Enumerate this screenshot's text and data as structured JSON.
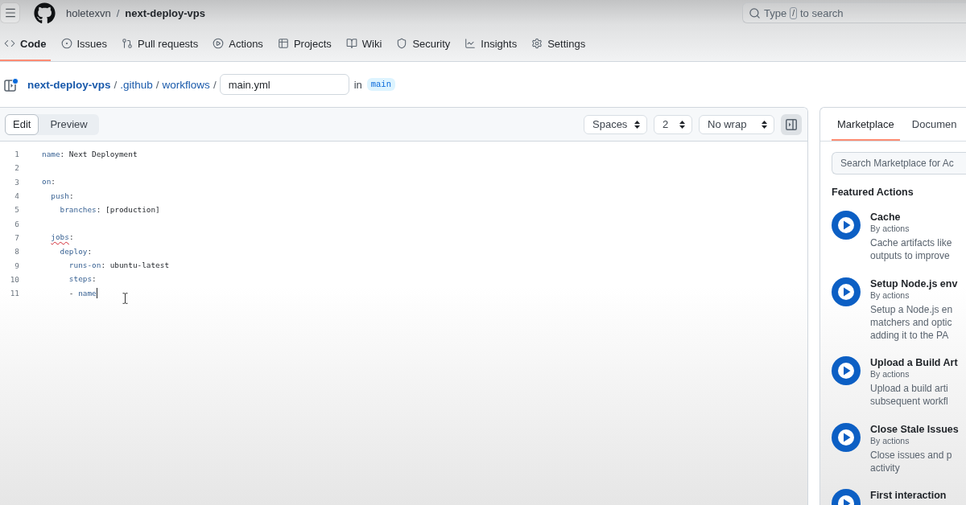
{
  "header": {
    "owner": "holetexvn",
    "separator": "/",
    "repo": "next-deploy-vps",
    "search": {
      "text_before_key": "Type",
      "shortcut_key": "/",
      "text_after_key": "to search"
    }
  },
  "nav_tabs": [
    {
      "label": "Code",
      "selected": true
    },
    {
      "label": "Issues",
      "selected": false
    },
    {
      "label": "Pull requests",
      "selected": false
    },
    {
      "label": "Actions",
      "selected": false
    },
    {
      "label": "Projects",
      "selected": false
    },
    {
      "label": "Wiki",
      "selected": false
    },
    {
      "label": "Security",
      "selected": false
    },
    {
      "label": "Insights",
      "selected": false
    },
    {
      "label": "Settings",
      "selected": false
    }
  ],
  "breadcrumb": {
    "crumbs": [
      {
        "kind": "repo",
        "text": "next-deploy-vps"
      },
      {
        "kind": "separator",
        "text": "/"
      },
      {
        "kind": "folder",
        "text": ".github"
      },
      {
        "kind": "separator",
        "text": "/"
      },
      {
        "kind": "folder",
        "text": "workflows"
      },
      {
        "kind": "separator",
        "text": "/"
      }
    ],
    "filename": {
      "value": "main.yml"
    },
    "branch_prefix": "in",
    "branch": "main"
  },
  "editor": {
    "tabs": [
      {
        "label": "Edit",
        "selected": true
      },
      {
        "label": "Preview",
        "selected": false
      }
    ],
    "selects": [
      {
        "value": "Spaces"
      },
      {
        "value": "2"
      },
      {
        "value": "No wrap"
      }
    ],
    "lines": [
      {
        "number": "1",
        "tokens": [
          {
            "kind": "key",
            "text": "name"
          },
          {
            "kind": "plain",
            "text": ": Next Deployment"
          }
        ],
        "squiggle": false,
        "caret": false
      },
      {
        "number": "2"
      },
      {
        "number": "3",
        "tokens": [
          {
            "kind": "key",
            "text": "on"
          },
          {
            "kind": "plain",
            "text": ":"
          }
        ],
        "squiggle": false,
        "caret": false
      },
      {
        "number": "4",
        "tokens": [
          {
            "kind": "key",
            "text": "  push"
          },
          {
            "kind": "plain",
            "text": ":"
          }
        ],
        "squiggle": false,
        "caret": false
      },
      {
        "number": "5",
        "tokens": [
          {
            "kind": "key",
            "text": "    branches"
          },
          {
            "kind": "plain",
            "text": ": [production]"
          }
        ],
        "squiggle": false,
        "caret": false
      },
      {
        "number": "6"
      },
      {
        "number": "7",
        "tokens": [
          {
            "kind": "key",
            "text": "  jobs"
          },
          {
            "kind": "plain",
            "text": ":"
          }
        ],
        "squiggle": true,
        "caret": false
      },
      {
        "number": "8",
        "tokens": [
          {
            "kind": "key",
            "text": "    deploy"
          },
          {
            "kind": "plain",
            "text": ":"
          }
        ],
        "squiggle": false,
        "caret": false
      },
      {
        "number": "9",
        "tokens": [
          {
            "kind": "key",
            "text": "      runs-on"
          },
          {
            "kind": "plain",
            "text": ": ubuntu-latest"
          }
        ],
        "squiggle": false,
        "caret": false
      },
      {
        "number": "10",
        "tokens": [
          {
            "kind": "key",
            "text": "      steps"
          },
          {
            "kind": "plain",
            "text": ":"
          }
        ],
        "squiggle": false,
        "caret": false
      },
      {
        "number": "11",
        "tokens": [
          {
            "kind": "plain",
            "text": "      - "
          },
          {
            "kind": "key",
            "text": "name"
          }
        ],
        "squiggle": false,
        "caret": true
      }
    ]
  },
  "sidebar": {
    "tabs": [
      {
        "label": "Marketplace",
        "selected": true
      },
      {
        "label": "Documen",
        "selected": false
      }
    ],
    "search": {
      "placeholder": "Search Marketplace for Ac"
    },
    "heading": "Featured Actions",
    "actions": [
      {
        "title": "Cache",
        "author": "By actions",
        "description_lines": [
          "Cache artifacts like",
          "outputs to improve"
        ]
      },
      {
        "title": "Setup Node.js env",
        "author": "By actions",
        "description_lines": [
          "Setup a Node.js en",
          "matchers and optic",
          "adding it to the PA"
        ]
      },
      {
        "title": "Upload a Build Art",
        "author": "By actions",
        "description_lines": [
          "Upload a build arti",
          "subsequent workfl"
        ]
      },
      {
        "title": "Close Stale Issues",
        "author": "By actions",
        "description_lines": [
          "Close issues and p",
          "activity"
        ]
      },
      {
        "title": "First interaction"
      }
    ]
  }
}
